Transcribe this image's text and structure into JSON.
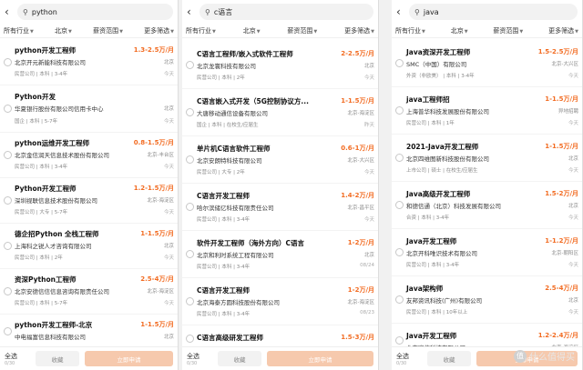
{
  "filters": {
    "industry": "所有行业",
    "city": "北京",
    "salary": "薪资范围",
    "more": "更多筛选"
  },
  "bottom": {
    "select_all": "全选",
    "select_count": "0/30",
    "favorite": "收藏",
    "apply": "立即申请"
  },
  "colors": {
    "accent": "#f26b21",
    "apply_disabled": "#f6c9ad"
  },
  "watermark": "什么值得买",
  "panels": [
    {
      "query": "python",
      "jobs": [
        {
          "title": "python开发工程师",
          "salary": "1.3-2.5万/月",
          "company": "北京开元新能科技有限公司",
          "city": "北京",
          "meta": "民营公司 | 本科 | 3-4年",
          "date": "今天"
        },
        {
          "title": "Python开发",
          "salary": "",
          "company": "华夏银行股份有限公司信用卡中心",
          "city": "北京",
          "meta": "国企 | 本科 | 5-7年",
          "date": "今天"
        },
        {
          "title": "python运维开发工程师",
          "salary": "0.8-1.5万/月",
          "company": "北京金信润天信息技术股份有限公司",
          "city": "北京-丰台区",
          "meta": "民营公司 | 本科 | 3-4年",
          "date": "今天"
        },
        {
          "title": "Python开发工程师",
          "salary": "1.2-1.5万/月",
          "company": "深圳视联信息技术股份有限公司",
          "city": "北京-海淀区",
          "meta": "民营公司 | 大专 | 5-7年",
          "date": "今天"
        },
        {
          "title": "德企招Python 全栈工程师",
          "salary": "1-1.5万/月",
          "company": "上海科之锐人才咨询有限公司",
          "city": "北京",
          "meta": "民营公司 | 本科 | 2年",
          "date": "今天"
        },
        {
          "title": "资深Python工程师",
          "salary": "2.5-4万/月",
          "company": "北京安德信信信息咨询有限责任公司",
          "city": "北京-海淀区",
          "meta": "民营公司 | 本科 | 5-7年",
          "date": "今天"
        },
        {
          "title": "python开发工程师-北京",
          "salary": "1-1.5万/月",
          "company": "中电福富信息科技有限公司",
          "city": "北京",
          "meta": "",
          "date": ""
        }
      ]
    },
    {
      "query": "c语言",
      "jobs": [
        {
          "title": "C语言工程师/嵌入式软件工程师",
          "salary": "2-2.5万/月",
          "company": "北京龙寰科技有限公司",
          "city": "北京",
          "meta": "民营公司 | 本科 | 2年",
          "date": "今天"
        },
        {
          "title": "C语言嵌入式开发（5G控制协议方...",
          "salary": "1-1.5万/月",
          "company": "大唐移动通信设备有限公司",
          "city": "北京-海淀区",
          "meta": "国企 | 本科 | 在校生/应届生",
          "date": "昨天"
        },
        {
          "title": "单片机C语言软件工程师",
          "salary": "0.6-1万/月",
          "company": "北京安朗特科技有限公司",
          "city": "北京-大兴区",
          "meta": "民营公司 | 大专 | 2年",
          "date": "今天"
        },
        {
          "title": "C语言开发工程师",
          "salary": "1.4-2万/月",
          "company": "哈尔滨储亿科技有限责任公司",
          "city": "北京-昌平区",
          "meta": "民营公司 | 本科 | 3-4年",
          "date": "今天"
        },
        {
          "title": "软件开发工程师（海外方向）C语言",
          "salary": "1-2万/月",
          "company": "北京和利时系统工程有限公司",
          "city": "北京",
          "meta": "民营公司 | 本科 | 3-4年",
          "date": "08/24"
        },
        {
          "title": "C语言开发工程师",
          "salary": "1-2万/月",
          "company": "北京海泰方圆科技股份有限公司",
          "city": "北京-海淀区",
          "meta": "民营公司 | 本科 | 3-4年",
          "date": "08/23"
        },
        {
          "title": "C语言高级研发工程师",
          "salary": "1.5-3万/月",
          "company": "",
          "city": "",
          "meta": "",
          "date": ""
        }
      ]
    },
    {
      "query": "java",
      "jobs": [
        {
          "title": "Java资深开发工程师",
          "salary": "1.5-2.5万/月",
          "company": "SMC（中国）有限公司",
          "city": "北京-大兴区",
          "meta": "外资（非欧美） | 本科 | 3-4年",
          "date": "今天"
        },
        {
          "title": "java工程师招",
          "salary": "1-1.5万/月",
          "company": "上海普华科技发展股份有限公司",
          "city": "异地招聘",
          "meta": "民营公司 | 本科 | 1年",
          "date": "今天"
        },
        {
          "title": "2021-Java开发工程师",
          "salary": "1-1.5万/月",
          "company": "北京四维图新科技股份有限公司",
          "city": "北京",
          "meta": "上市公司 | 硕士 | 在校生/应届生",
          "date": "今天"
        },
        {
          "title": "Java高级开发工程师",
          "salary": "1.5-2万/月",
          "company": "和德信通（北京）科技发展有限公司",
          "city": "北京",
          "meta": "合资 | 本科 | 3-4年",
          "date": "今天"
        },
        {
          "title": "Java开发工程师",
          "salary": "1-1.2万/月",
          "company": "北京开科唯识技术有限公司",
          "city": "北京-朝阳区",
          "meta": "民营公司 | 本科 | 3-4年",
          "date": "今天"
        },
        {
          "title": "Java架构师",
          "salary": "2.5-4万/月",
          "company": "友邦资讯科技(广州)有限公司",
          "city": "北京",
          "meta": "民营公司 | 本科 | 10年以上",
          "date": "今天"
        },
        {
          "title": "Java开发工程师",
          "salary": "1.2-2.4万/月",
          "company": "北京宽信科技有限公司",
          "city": "北京-海淀区",
          "meta": "",
          "date": ""
        }
      ]
    }
  ]
}
